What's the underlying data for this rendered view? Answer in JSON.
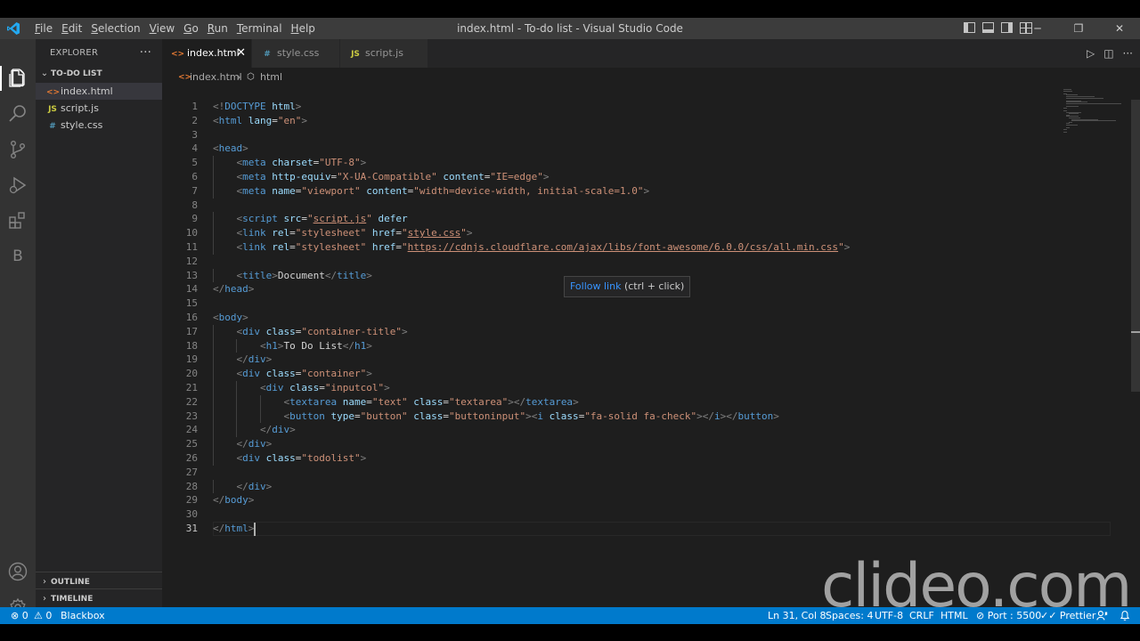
{
  "window": {
    "title": "index.html - To-do list - Visual Studio Code",
    "menu": [
      "File",
      "Edit",
      "Selection",
      "View",
      "Go",
      "Run",
      "Terminal",
      "Help"
    ],
    "controls": {
      "minimize": "─",
      "restore": "❐",
      "close": "✕"
    }
  },
  "activity_bar": {
    "items": [
      "files-icon",
      "search-icon",
      "source-control-icon",
      "run-debug-icon",
      "extensions-icon",
      "blackbox-icon"
    ],
    "blackbox_letter": "B",
    "bottom": [
      "account-icon",
      "manage-gear-icon"
    ]
  },
  "sidebar": {
    "title": "EXPLORER",
    "more": "···",
    "folder": "TO-DO LIST",
    "files": [
      {
        "icon": "<>",
        "name": "index.html",
        "color": "#e37933"
      },
      {
        "icon": "JS",
        "name": "script.js",
        "color": "#cbcb41"
      },
      {
        "icon": "#",
        "name": "style.css",
        "color": "#519aba"
      }
    ],
    "outline": "OUTLINE",
    "timeline": "TIMELINE"
  },
  "tabs": [
    {
      "icon": "<>",
      "label": "index.html",
      "color": "#e37933",
      "close": "✕"
    },
    {
      "icon": "#",
      "label": "style.css",
      "color": "#519aba"
    },
    {
      "icon": "JS",
      "label": "script.js",
      "color": "#cbcb41"
    }
  ],
  "tab_actions": {
    "run": "▷",
    "split": "◫",
    "more": "···"
  },
  "breadcrumb": {
    "file": "index.html",
    "separator": "›",
    "element": "html",
    "element_icon": "⬡"
  },
  "editor": {
    "lines": [
      [
        "1",
        "<!DOCTYPE html>"
      ],
      [
        "2",
        "<html lang=\"en\">"
      ],
      [
        "3",
        ""
      ],
      [
        "4",
        "<head>"
      ],
      [
        "5",
        "    <meta charset=\"UTF-8\">"
      ],
      [
        "6",
        "    <meta http-equiv=\"X-UA-Compatible\" content=\"IE=edge\">"
      ],
      [
        "7",
        "    <meta name=\"viewport\" content=\"width=device-width, initial-scale=1.0\">"
      ],
      [
        "8",
        ""
      ],
      [
        "9",
        "    <script src=\"script.js\" defer"
      ],
      [
        "10",
        "    <link rel=\"stylesheet\" href=\"style.css\">"
      ],
      [
        "11",
        "    <link rel=\"stylesheet\" href=\"https://cdnjs.cloudflare.com/ajax/libs/font-awesome/6.0.0/css/all.min.css\">"
      ],
      [
        "12",
        ""
      ],
      [
        "13",
        "    <title>Document</title>"
      ],
      [
        "14",
        "</head>"
      ],
      [
        "15",
        ""
      ],
      [
        "16",
        "<body>"
      ],
      [
        "17",
        "    <div class=\"container-title\">"
      ],
      [
        "18",
        "        <h1>To Do List</h1>"
      ],
      [
        "19",
        "    </div>"
      ],
      [
        "20",
        "    <div class=\"container\">"
      ],
      [
        "21",
        "        <div class=\"inputcol\">"
      ],
      [
        "22",
        "            <textarea name=\"text\" class=\"textarea\"></textarea>"
      ],
      [
        "23",
        "            <button type=\"button\" class=\"buttoninput\"><i class=\"fa-solid fa-check\"></i></button>"
      ],
      [
        "24",
        "        </div>"
      ],
      [
        "25",
        "    </div>"
      ],
      [
        "26",
        "    <div class=\"todolist\">"
      ],
      [
        "27",
        ""
      ],
      [
        "28",
        "    </div>"
      ],
      [
        "29",
        "</body>"
      ],
      [
        "30",
        ""
      ],
      [
        "31",
        "</html>"
      ]
    ],
    "current_line": 31,
    "tooltip": {
      "link": "Follow link",
      "hint": "(ctrl + click)"
    }
  },
  "watermark": "clideo.com",
  "statusbar": {
    "errors": "⊗ 0",
    "warnings": "⚠ 0",
    "blackbox": "Blackbox",
    "position": "Ln 31, Col 8",
    "spaces": "Spaces: 4",
    "encoding": "UTF-8",
    "eol": "CRLF",
    "language": "HTML",
    "port": "⊘ Port : 5500",
    "prettier": "✓✓ Prettier",
    "feedback_icon": "person-feedback-icon",
    "bell_icon": "bell-icon",
    "background": "#007acc"
  }
}
